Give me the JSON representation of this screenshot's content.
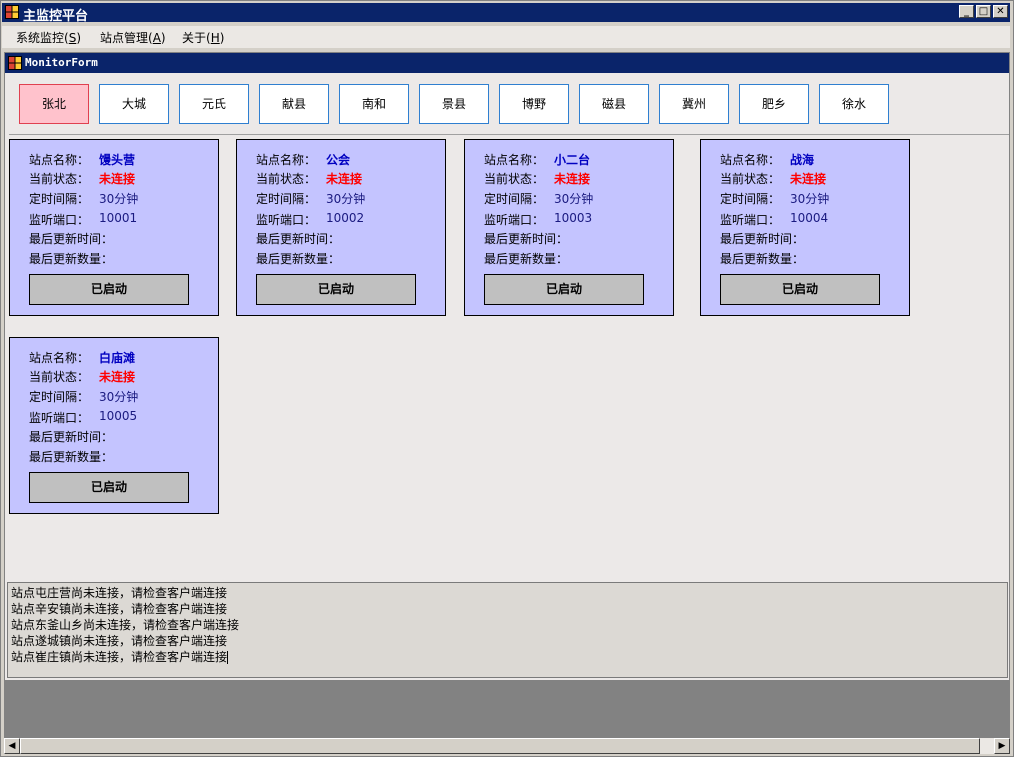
{
  "window": {
    "title": "主监控平台"
  },
  "menu": {
    "items": [
      {
        "label": "系统监控",
        "key": "S"
      },
      {
        "label": "站点管理",
        "key": "A"
      },
      {
        "label": "关于",
        "key": "H"
      }
    ]
  },
  "child_window": {
    "title": "MonitorForm"
  },
  "station_tabs": [
    "张北",
    "大城",
    "元氏",
    "献县",
    "南和",
    "景县",
    "博野",
    "磁县",
    "冀州",
    "肥乡",
    "徐水"
  ],
  "card_labels": {
    "name": "站点名称：",
    "status": "当前状态：",
    "interval": "定时间隔：",
    "port": "监听端口：",
    "last_time": "最后更新时间：",
    "last_count": "最后更新数量："
  },
  "cards": [
    {
      "name": "馒头营",
      "status": "未连接",
      "interval": "30分钟",
      "port": "10001",
      "button": "已启动"
    },
    {
      "name": "公会",
      "status": "未连接",
      "interval": "30分钟",
      "port": "10002",
      "button": "已启动"
    },
    {
      "name": "小二台",
      "status": "未连接",
      "interval": "30分钟",
      "port": "10003",
      "button": "已启动"
    },
    {
      "name": "战海",
      "status": "未连接",
      "interval": "30分钟",
      "port": "10004",
      "button": "已启动"
    },
    {
      "name": "白庙滩",
      "status": "未连接",
      "interval": "30分钟",
      "port": "10005",
      "button": "已启动"
    }
  ],
  "log": [
    "站点屯庄营尚未连接，请检查客户端连接",
    "站点辛安镇尚未连接，请检查客户端连接",
    "站点东釜山乡尚未连接，请检查客户端连接",
    "站点遂城镇尚未连接，请检查客户端连接",
    "站点崔庄镇尚未连接，请检查客户端连接"
  ],
  "colors": {
    "titlebar": "#0a246a",
    "card_bg": "#c4c4ff",
    "active_tab": "#ffc2cc",
    "status_red": "#ff0000",
    "name_blue": "#0000c0"
  }
}
